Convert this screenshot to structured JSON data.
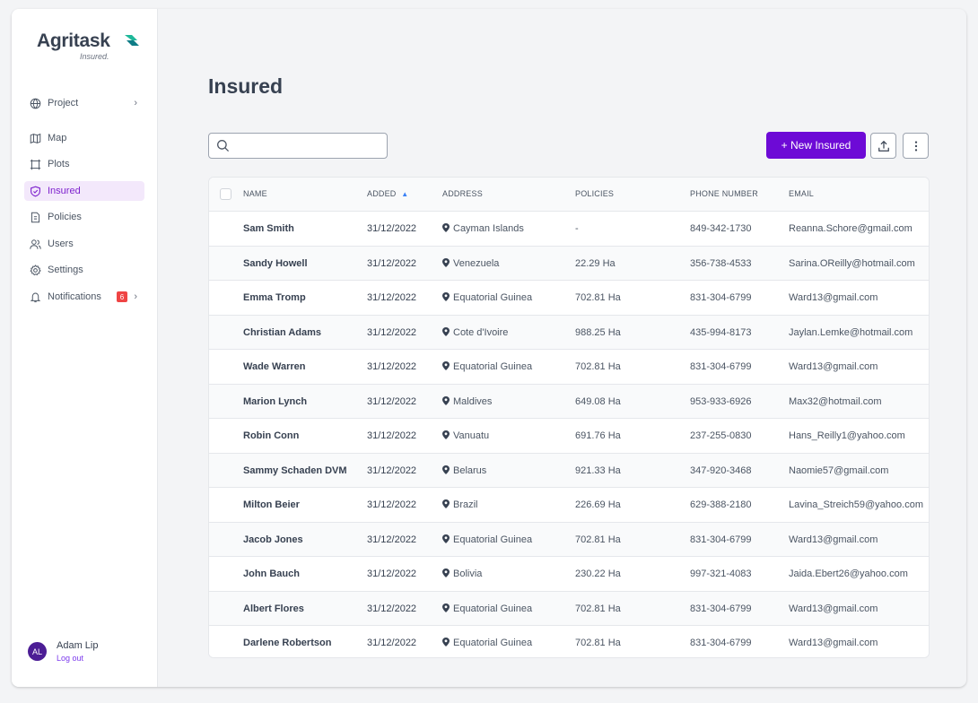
{
  "brand": {
    "name": "Agritask",
    "sub": "Insured."
  },
  "sidebar": {
    "items": [
      {
        "label": "Project",
        "icon": "globe-icon"
      },
      {
        "label": "Map",
        "icon": "map-icon"
      },
      {
        "label": "Plots",
        "icon": "plots-icon"
      },
      {
        "label": "Insured",
        "icon": "shield-icon",
        "active": true
      },
      {
        "label": "Policies",
        "icon": "document-icon"
      },
      {
        "label": "Users",
        "icon": "users-icon"
      },
      {
        "label": "Settings",
        "icon": "gear-icon"
      },
      {
        "label": "Notifications",
        "icon": "bell-icon",
        "badge": "6"
      }
    ],
    "chevron": "›"
  },
  "user": {
    "initials": "AL",
    "name": "Adam Lip",
    "logout": "Log out"
  },
  "main": {
    "title": "Insured",
    "search_placeholder": "",
    "new_button": "+ New Insured"
  },
  "table": {
    "headers": {
      "name": "NAME",
      "added": "ADDED",
      "address": "ADDRESS",
      "policies": "POLICIES",
      "phone": "PHONE NUMBER",
      "email": "EMAIL"
    },
    "sort_indicator": "▲",
    "rows": [
      {
        "name": "Sam Smith",
        "added": "31/12/2022",
        "address": "Cayman Islands",
        "policies": "-",
        "phone": "849-342-1730",
        "email": "Reanna.Schore@gmail.com"
      },
      {
        "name": "Sandy Howell",
        "added": "31/12/2022",
        "address": "Venezuela",
        "policies": "22.29 Ha",
        "phone": "356-738-4533",
        "email": "Sarina.OReilly@hotmail.com"
      },
      {
        "name": "Emma Tromp",
        "added": "31/12/2022",
        "address": "Equatorial Guinea",
        "policies": "702.81 Ha",
        "phone": "831-304-6799",
        "email": "Ward13@gmail.com"
      },
      {
        "name": "Christian Adams",
        "added": "31/12/2022",
        "address": "Cote d'Ivoire",
        "policies": "988.25 Ha",
        "phone": "435-994-8173",
        "email": "Jaylan.Lemke@hotmail.com"
      },
      {
        "name": "Wade Warren",
        "added": "31/12/2022",
        "address": "Equatorial Guinea",
        "policies": "702.81 Ha",
        "phone": "831-304-6799",
        "email": "Ward13@gmail.com"
      },
      {
        "name": "Marion Lynch",
        "added": "31/12/2022",
        "address": "Maldives",
        "policies": "649.08 Ha",
        "phone": "953-933-6926",
        "email": "Max32@hotmail.com"
      },
      {
        "name": "Robin Conn",
        "added": "31/12/2022",
        "address": "Vanuatu",
        "policies": "691.76 Ha",
        "phone": "237-255-0830",
        "email": "Hans_Reilly1@yahoo.com"
      },
      {
        "name": "Sammy Schaden DVM",
        "added": "31/12/2022",
        "address": "Belarus",
        "policies": "921.33 Ha",
        "phone": "347-920-3468",
        "email": "Naomie57@gmail.com"
      },
      {
        "name": "Milton Beier",
        "added": "31/12/2022",
        "address": "Brazil",
        "policies": "226.69 Ha",
        "phone": "629-388-2180",
        "email": "Lavina_Streich59@yahoo.com"
      },
      {
        "name": "Jacob Jones",
        "added": "31/12/2022",
        "address": "Equatorial Guinea",
        "policies": "702.81 Ha",
        "phone": "831-304-6799",
        "email": "Ward13@gmail.com"
      },
      {
        "name": "John Bauch",
        "added": "31/12/2022",
        "address": "Bolivia",
        "policies": "230.22 Ha",
        "phone": "997-321-4083",
        "email": "Jaida.Ebert26@yahoo.com"
      },
      {
        "name": "Albert Flores",
        "added": "31/12/2022",
        "address": "Equatorial Guinea",
        "policies": "702.81 Ha",
        "phone": "831-304-6799",
        "email": "Ward13@gmail.com"
      },
      {
        "name": "Darlene Robertson",
        "added": "31/12/2022",
        "address": "Equatorial Guinea",
        "policies": "702.81 Ha",
        "phone": "831-304-6799",
        "email": "Ward13@gmail.com"
      }
    ]
  },
  "colors": {
    "accent": "#6d0ad6",
    "active_bg": "#f3e8fb",
    "badge": "#ef4444",
    "avatar": "#4c1d95"
  }
}
